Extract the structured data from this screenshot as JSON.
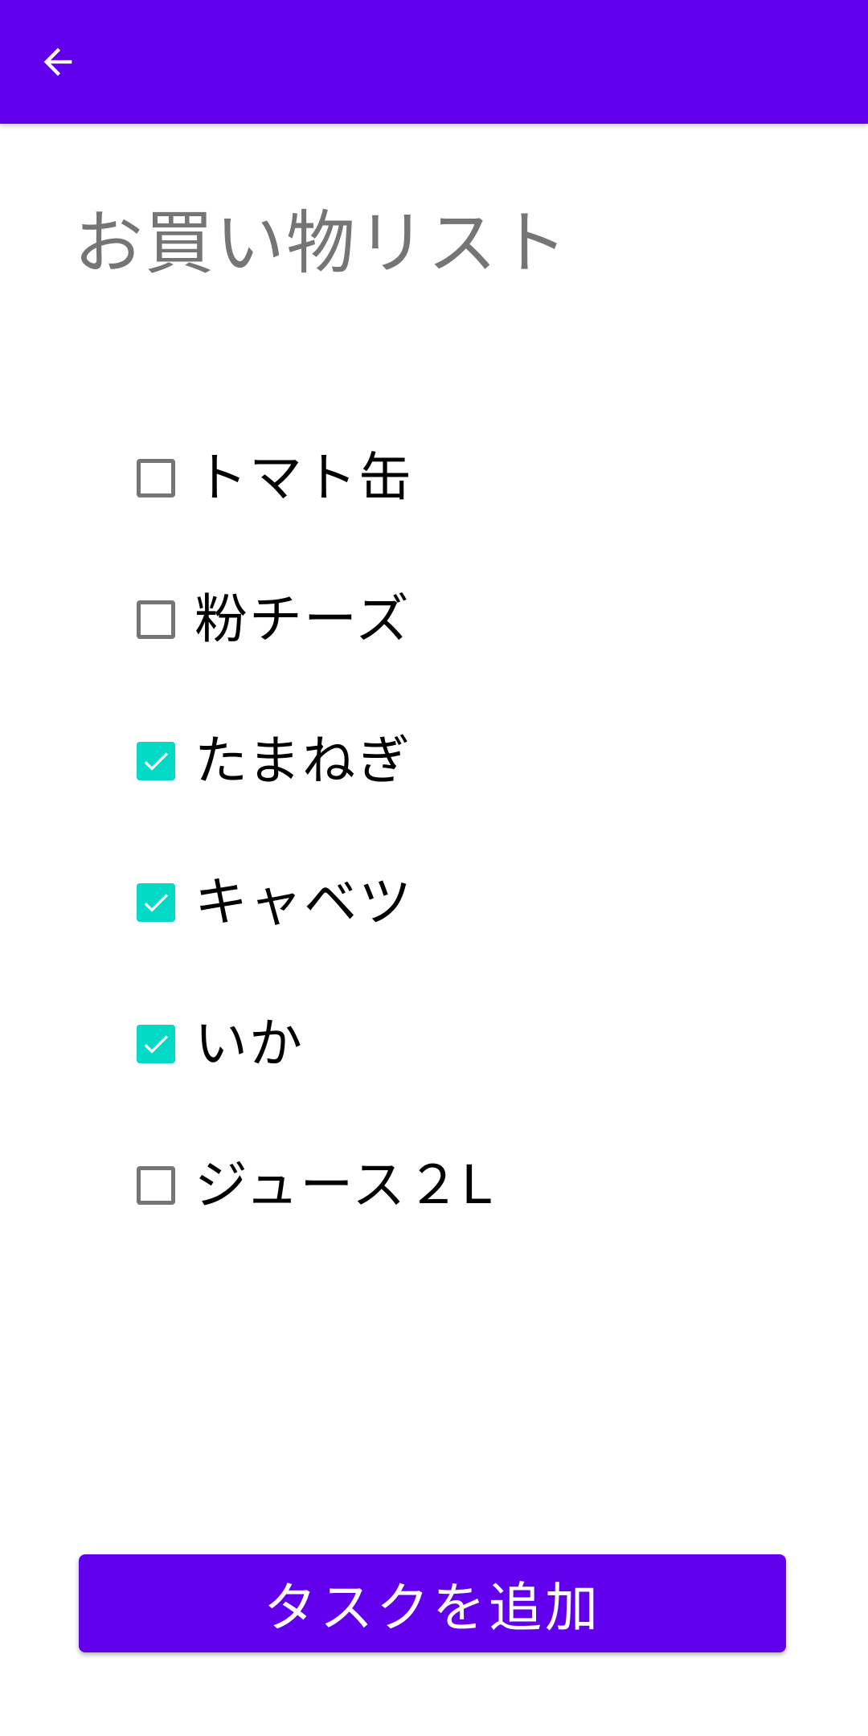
{
  "colors": {
    "primary": "#6200EE",
    "accent": "#03DAC5",
    "title_text": "#757575",
    "item_text": "#000000"
  },
  "appbar": {
    "back_icon": "arrow-back-icon"
  },
  "page": {
    "title": "お買い物リスト"
  },
  "tasks": [
    {
      "label": "トマト缶",
      "checked": false
    },
    {
      "label": "粉チーズ",
      "checked": false
    },
    {
      "label": "たまねぎ",
      "checked": true
    },
    {
      "label": "キャベツ",
      "checked": true
    },
    {
      "label": "いか",
      "checked": true
    },
    {
      "label": "ジュース２L",
      "checked": false
    }
  ],
  "footer": {
    "add_task_label": "タスクを追加"
  }
}
